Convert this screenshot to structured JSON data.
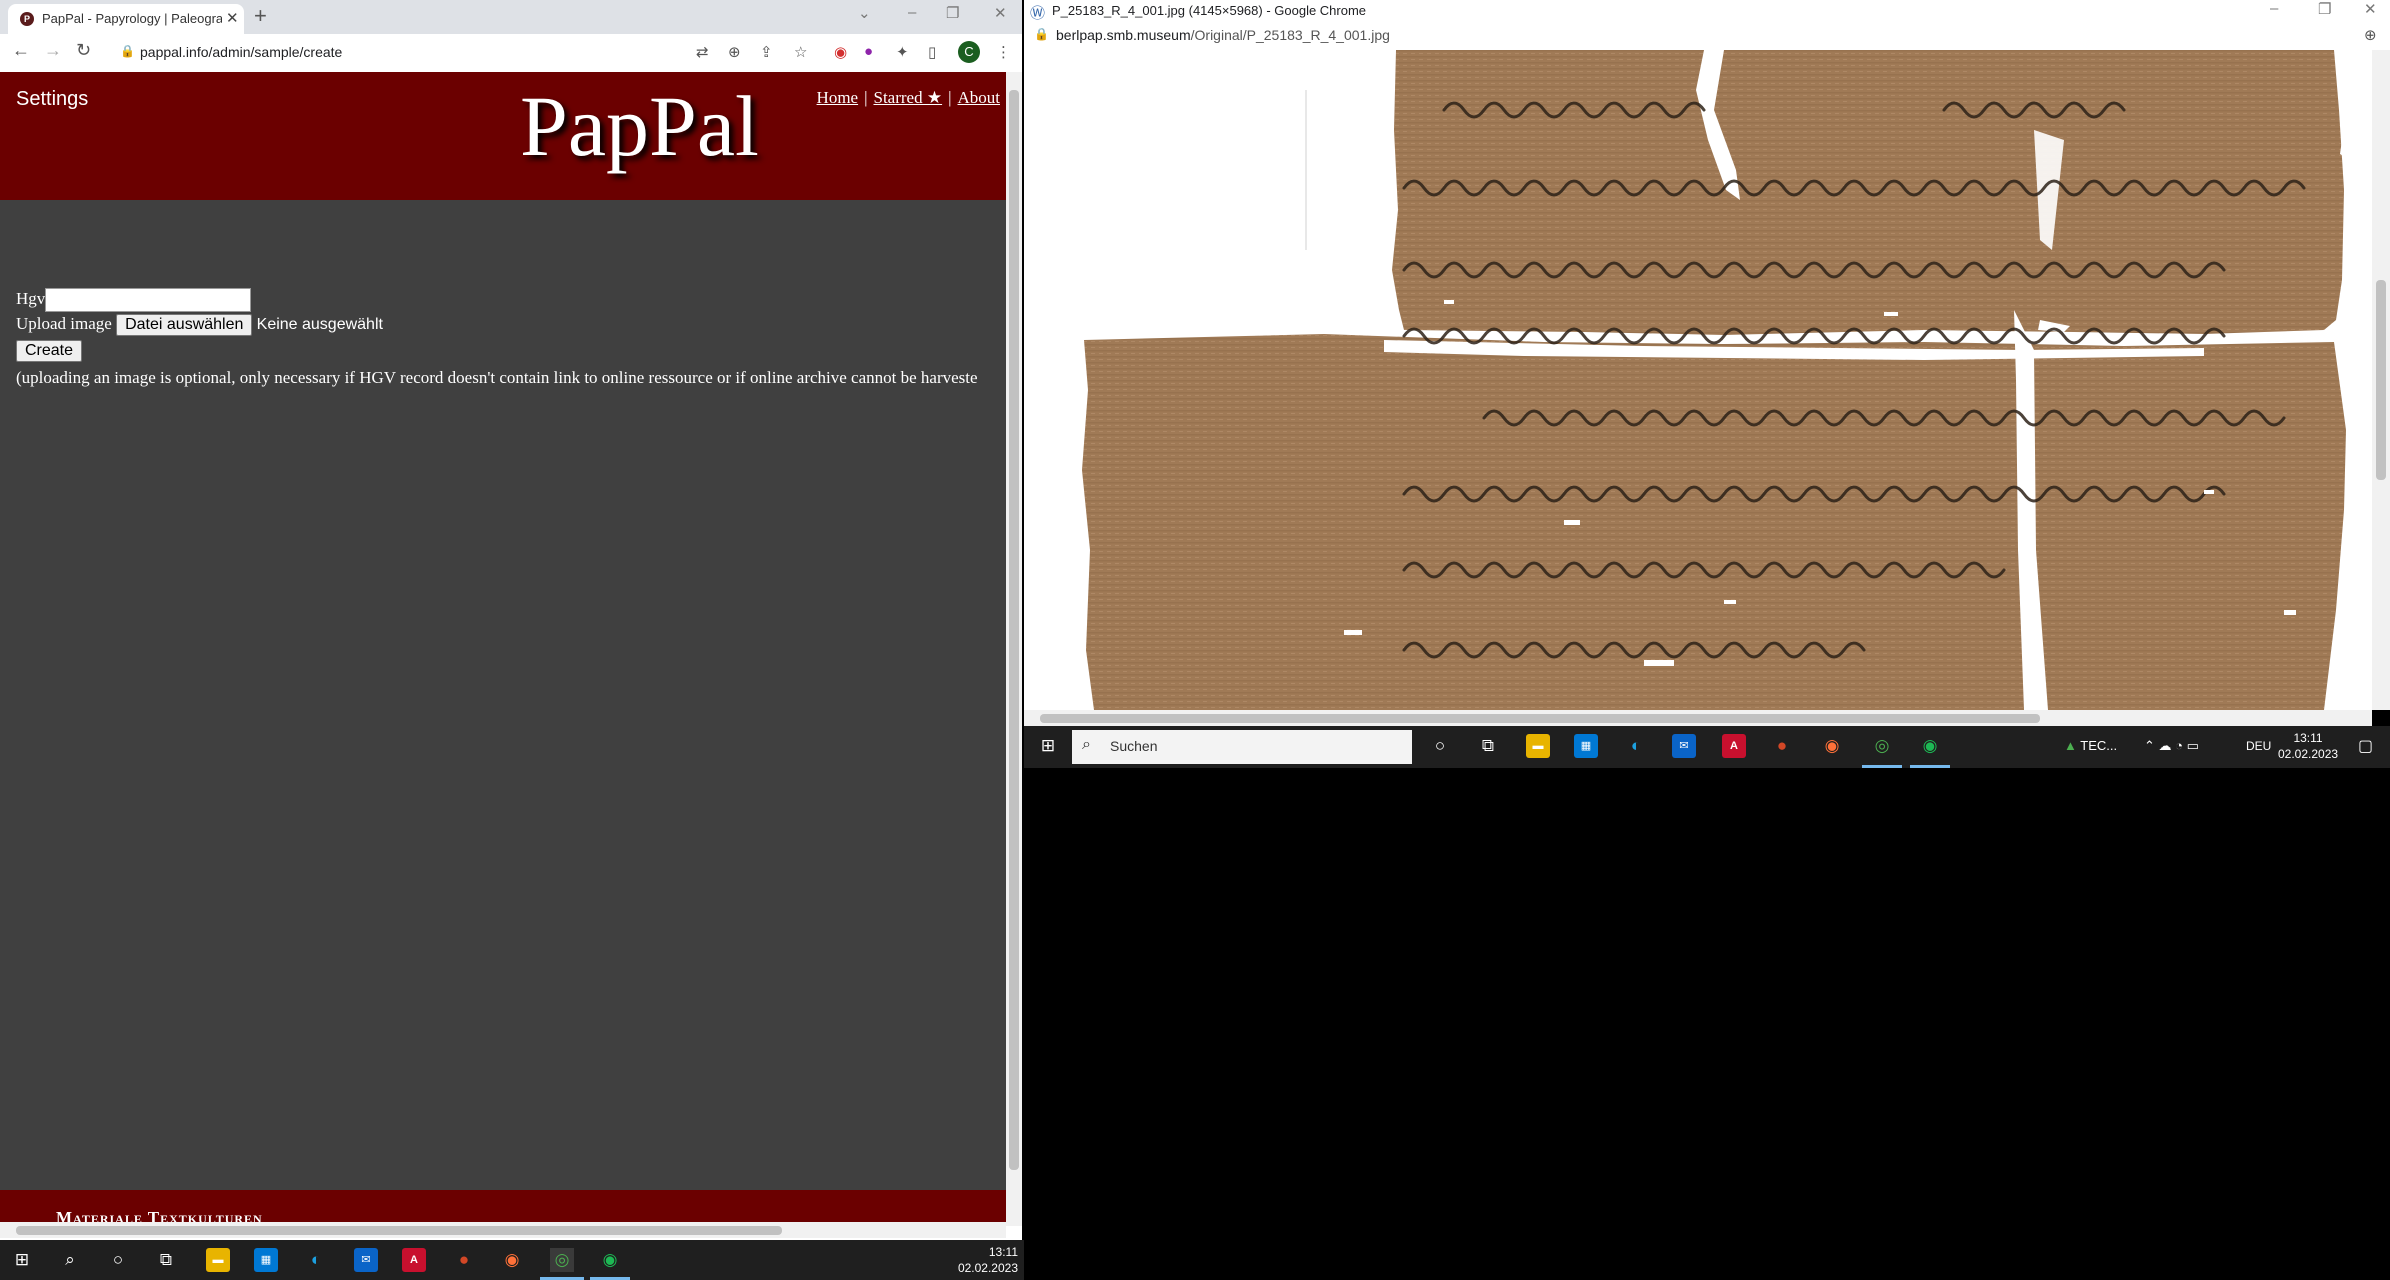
{
  "left_browser": {
    "tab_title": "PapPal - Papyrology | Paleograph",
    "new_tab_icon": "+",
    "url": "pappal.info/admin/sample/create",
    "profile_initial": "C"
  },
  "site": {
    "settings_label": "Settings",
    "logo": "PapPal",
    "nav": [
      {
        "label": "Home"
      },
      {
        "label": "Starred ★"
      },
      {
        "label": "About"
      }
    ],
    "nav_separator": "|",
    "form": {
      "hgv_label": "Hgv",
      "hgv_value": "",
      "upload_label": "Upload image",
      "choose_file_button": "Datei auswählen",
      "no_file_text": "Keine ausgewählt",
      "create_button": "Create",
      "note": "(uploading an image is optional, only necessary if HGV record doesn't contain link to online ressource or if online archive cannot be harveste"
    },
    "footer_brand": "Materiale Textkulturen",
    "colors": {
      "header_bg": "#6b0000",
      "body_bg": "#404040"
    }
  },
  "right_browser": {
    "window_title": "P_25183_R_4_001.jpg (4145×5968) - Google Chrome",
    "url_host": "berlpap.smb.museum",
    "url_path": "/Original/P_25183_R_4_001.jpg",
    "taskbar": {
      "search_placeholder": "Suchen",
      "tray_text": "TEC...",
      "lang": "DEU",
      "time": "13:11",
      "date": "02.02.2023"
    }
  },
  "taskbar": {
    "time": "13:11",
    "date": "02.02.2023",
    "icons": [
      "windows-start-icon",
      "search-icon",
      "cortana-icon",
      "task-view-icon",
      "file-explorer-icon",
      "store-icon",
      "edge-icon",
      "mail-icon",
      "acrobat-icon",
      "powerpoint-icon",
      "firefox-icon",
      "chrome-icon",
      "spotify-icon"
    ]
  }
}
